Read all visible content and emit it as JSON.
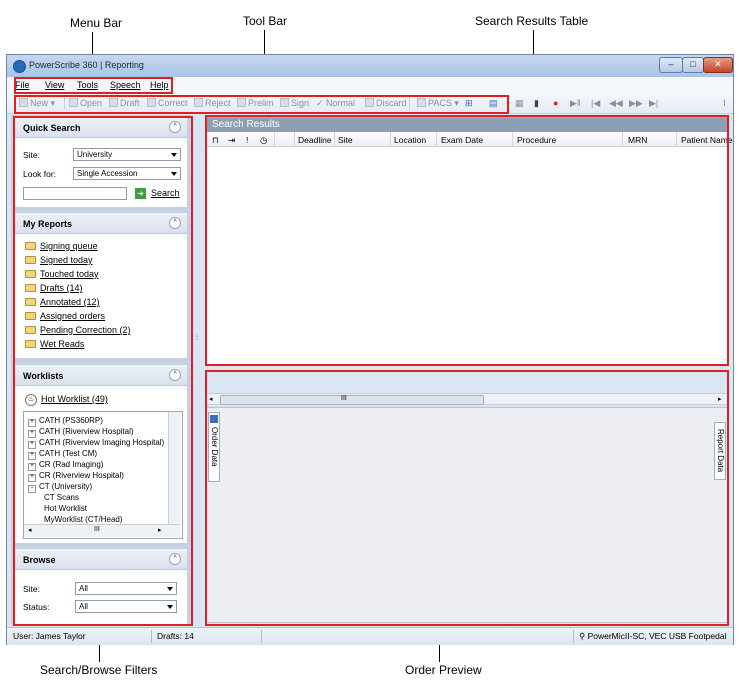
{
  "annotations": {
    "menu_bar": "Menu Bar",
    "tool_bar": "Tool Bar",
    "search_results_table": "Search Results Table",
    "search_browse_filters": "Search/Browse Filters",
    "order_preview": "Order Preview"
  },
  "window": {
    "title": "PowerScribe 360 | Reporting",
    "minimize": "–",
    "maximize": "□",
    "close": "✕"
  },
  "menu": [
    "File",
    "View",
    "Tools",
    "Speech",
    "Help"
  ],
  "toolbar": {
    "new": "New",
    "open": "Open",
    "draft": "Draft",
    "correct": "Correct",
    "reject": "Reject",
    "prelim": "Prelim",
    "sign": "Sign",
    "normal": "Normal",
    "discard": "Discard",
    "pacs": "PACS"
  },
  "quick_search": {
    "title": "Quick Search",
    "site_label": "Site:",
    "site_value": "University",
    "look_for_label": "Look for:",
    "look_for_value": "Single Accession",
    "search_label": "Search"
  },
  "my_reports": {
    "title": "My Reports",
    "items": [
      "Signing queue",
      "Signed today",
      "Touched today",
      "Drafts (14)",
      "Annotated (12)",
      "Assigned orders",
      "Pending Correction (2)",
      "Wet Reads"
    ]
  },
  "worklists": {
    "title": "Worklists",
    "hot": "Hot Worklist (49)",
    "tree": [
      "CATH (PS360RP)",
      "CATH (Riverview Hospital)",
      "CATH (Riverview Imaging Hospital)",
      "CATH (Test CM)",
      "CR (Rad Imaging)",
      "CR (Riverview Hospital)",
      "CT (University)",
      "CT Scans",
      "Hot Worklist",
      "MyWorklist (CT/Head)"
    ],
    "scroll_mid": "III"
  },
  "browse": {
    "title": "Browse",
    "site_label": "Site:",
    "site_value": "All",
    "status_label": "Status:",
    "status_value": "All"
  },
  "results": {
    "title": "Search Results",
    "columns": [
      "Deadline",
      "Site",
      "Location",
      "Exam Date",
      "Procedure",
      "MRN",
      "Patient Name"
    ],
    "scroll_mid": "III"
  },
  "preview": {
    "order_data": "Order Data",
    "report_data": "Report Data"
  },
  "status": {
    "user": "User: James Taylor",
    "drafts": "Drafts: 14",
    "device": "PowerMicII-SC, VEC USB Footpedal"
  }
}
